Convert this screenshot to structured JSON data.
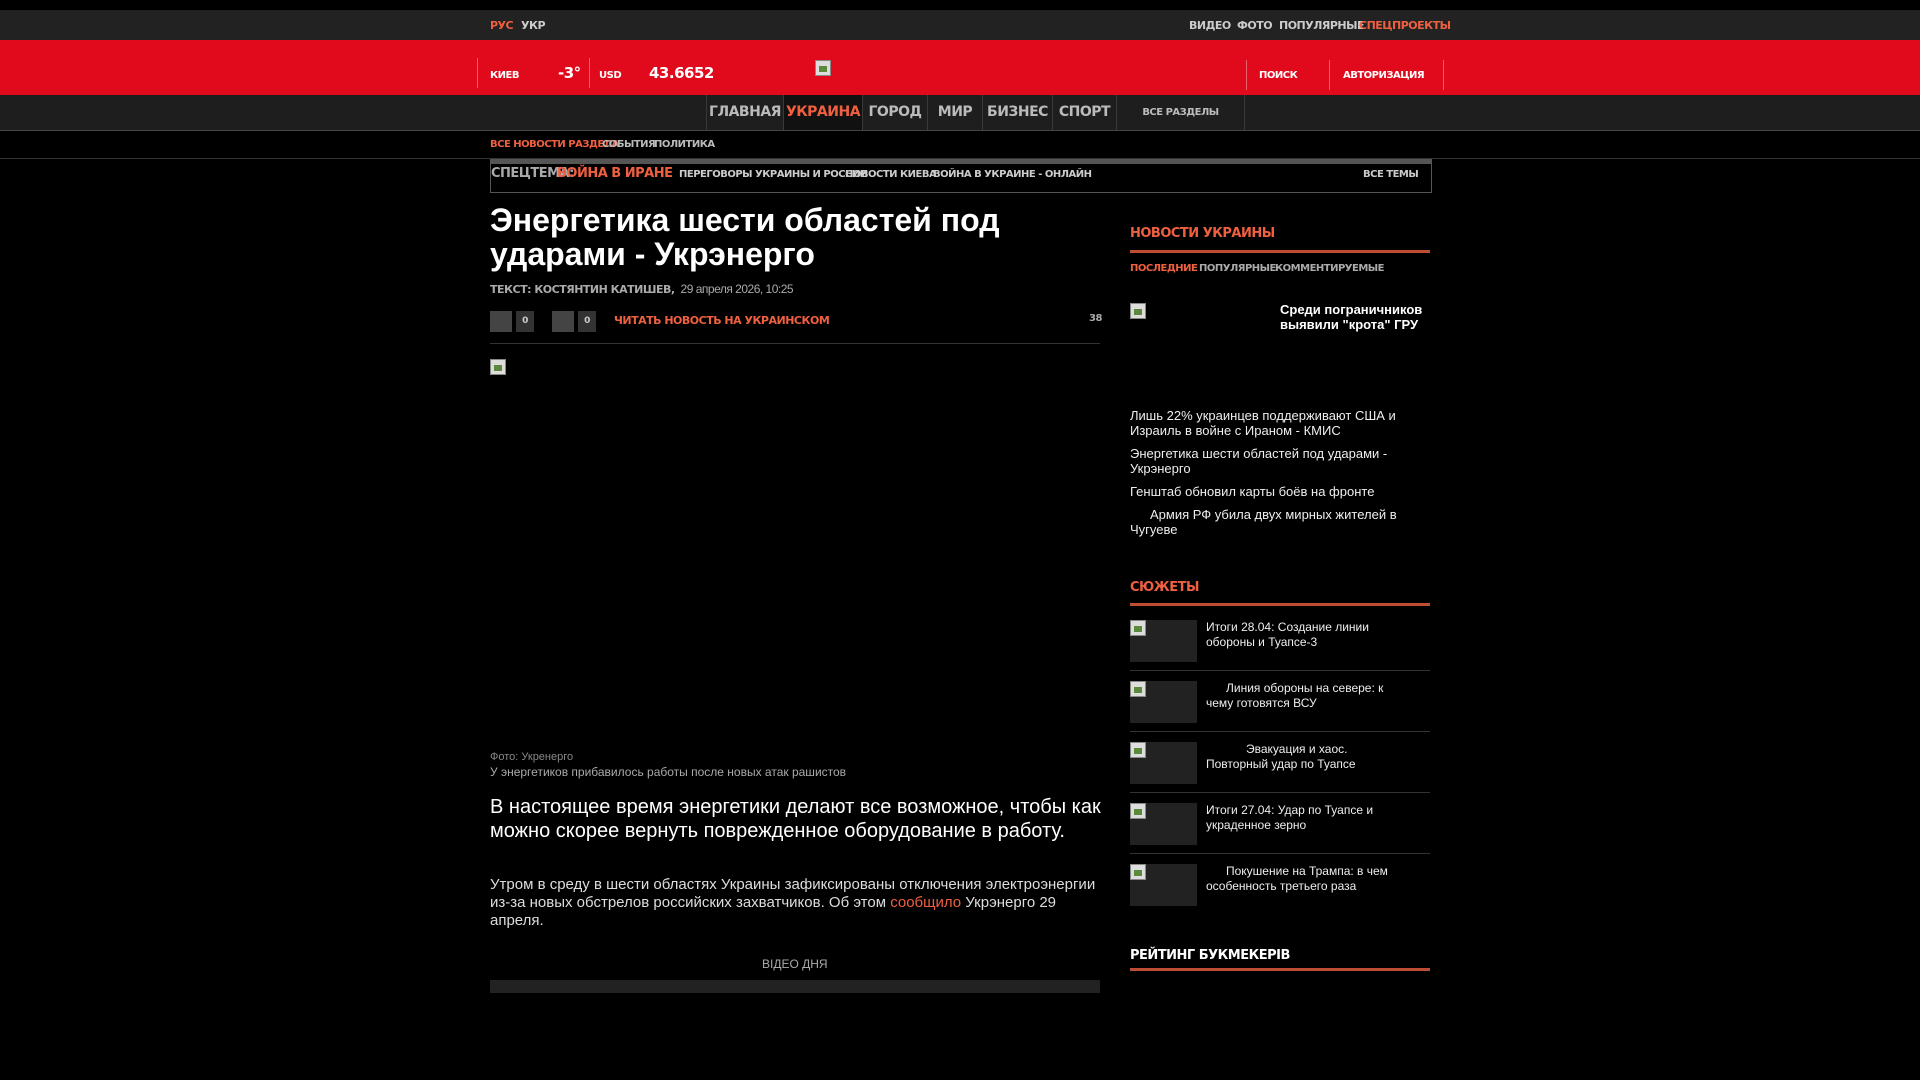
{
  "topbar": {
    "lang_ru": "РУС",
    "lang_ua": "УКР",
    "nav": [
      "ВИДЕО",
      "ФОТО",
      "ПОПУЛЯРНЫЕ",
      "СПЕЦПРОЕКТЫ"
    ]
  },
  "header": {
    "city": "КИЕВ",
    "temp": "-3°",
    "currency": "USD",
    "rate": "43.6652",
    "search": "ПОИСК",
    "login": "АВТОРИЗАЦИЯ"
  },
  "mainnav": {
    "items": [
      "ГЛАВНАЯ",
      "УКРАИНА",
      "ГОРОД",
      "МИР",
      "БИЗНЕС",
      "СПОРТ"
    ],
    "all": "ВСЕ РАЗДЕЛЫ"
  },
  "subnav": [
    "ВСЕ НОВОСТИ РАЗДЕЛА",
    "СОБЫТИЯ",
    "ПОЛИТИКА"
  ],
  "spec": {
    "label": "СПЕЦТЕМА:",
    "topic": "ВОЙНА В ИРАНЕ",
    "links": [
      "ПЕРЕГОВОРЫ УКРАИНЫ И РОССИИ",
      "НОВОСТИ КИЕВА",
      "ВОЙНА В УКРАИНЕ - ОНЛАЙН"
    ],
    "all": "ВСЕ ТЕМЫ"
  },
  "article": {
    "title": "Энергетика шести областей под ударами - Укрэнерго",
    "author": "ТЕКСТ: КОСТЯНТИН КАТИШЕВ,",
    "date": "29 апреля 2026, 10:25",
    "share1_count": "0",
    "share2_count": "0",
    "read_ua": "ЧИТАТЬ НОВОСТЬ НА УКРАИНСКОМ",
    "views": "38",
    "photo_credit": "Фото: Укренерго",
    "caption": "У энергетиков прибавилось работы после новых атак рашистов",
    "lead": "В настоящее время энергетики делают все возможное, чтобы как можно скорее вернуть поврежденное оборудование в работу.",
    "body_before": "Утром в среду в шести областях Украины зафиксированы отключения электроэнергии из-за новых обстрелов российских захватчиков. Об этом ",
    "body_link": "сообщило",
    "body_after": " Укрэнерго 29 апреля.",
    "video_label": "ВІДЕО ДНЯ"
  },
  "sidebar": {
    "news_title": "НОВОСТИ УКРАИНЫ",
    "tabs": [
      "ПОСЛЕДНИЕ",
      "ПОПУЛЯРНЫЕ",
      "КОММЕНТИРУЕМЫЕ"
    ],
    "featured": "Среди пограничников выявили \"крота\" ГРУ",
    "news": [
      "Лишь 22% украинцев поддерживают США и Израиль в войне с Ираном - КМИС",
      "Энергетика шести областей под ударами - Укрэнерго",
      "Генштаб обновил карты боёв на фронте",
      "Армия РФ убила двух мирных жителей в Чугуеве"
    ],
    "stories_title": "СЮЖЕТЫ",
    "stories": [
      "Итоги 28.04: Создание линии обороны и Туапсе-3",
      "Линия обороны на севере: к чему готовятся ВСУ",
      "Эвакуация и хаос. Повторный удар по Туапсе",
      "Итоги 27.04: Удар по Туапсе и украденное зерно",
      "Покушение на Трампа: в чем особенность третьего раза"
    ],
    "rating_title": "РЕЙТИНГ БУКМЕКЕРІВ"
  },
  "colors": {
    "accent": "#ef6041",
    "header_red": "#e00a1c"
  }
}
